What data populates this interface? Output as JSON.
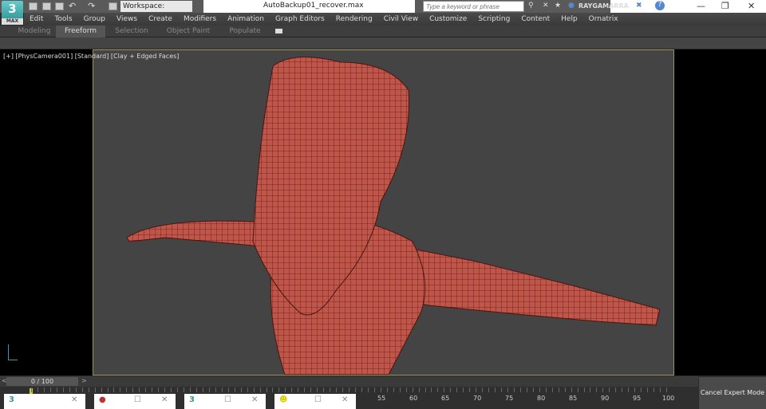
{
  "app": {
    "logo": "3",
    "logo_sub": "MAX",
    "workspace": "Workspace: Default",
    "title": "AutoBackup01_recover.max",
    "search_placeholder": "Type a keyword or phrase",
    "user": "RAYGAMARRA"
  },
  "menu": [
    "Edit",
    "Tools",
    "Group",
    "Views",
    "Create",
    "Modifiers",
    "Animation",
    "Graph Editors",
    "Rendering",
    "Civil View",
    "Customize",
    "Scripting",
    "Content",
    "Help",
    "Ornatrix"
  ],
  "ribbon_tabs": [
    "Modeling",
    "Freeform",
    "Selection",
    "Object Paint",
    "Populate"
  ],
  "viewport": {
    "label": "[+] [PhysCamera001] [Standard] [Clay + Edged Faces]"
  },
  "timeline": {
    "frame": "0 / 100",
    "prev": "<",
    "next": ">",
    "ticks": [
      "55",
      "60",
      "65",
      "70",
      "75",
      "80",
      "85",
      "90",
      "95",
      "100"
    ]
  },
  "cancel_expert": "Cancel Expert Mode",
  "colors": {
    "mesh": "#c0564a",
    "viewport_bg": "#444444",
    "border": "#9a9355"
  }
}
